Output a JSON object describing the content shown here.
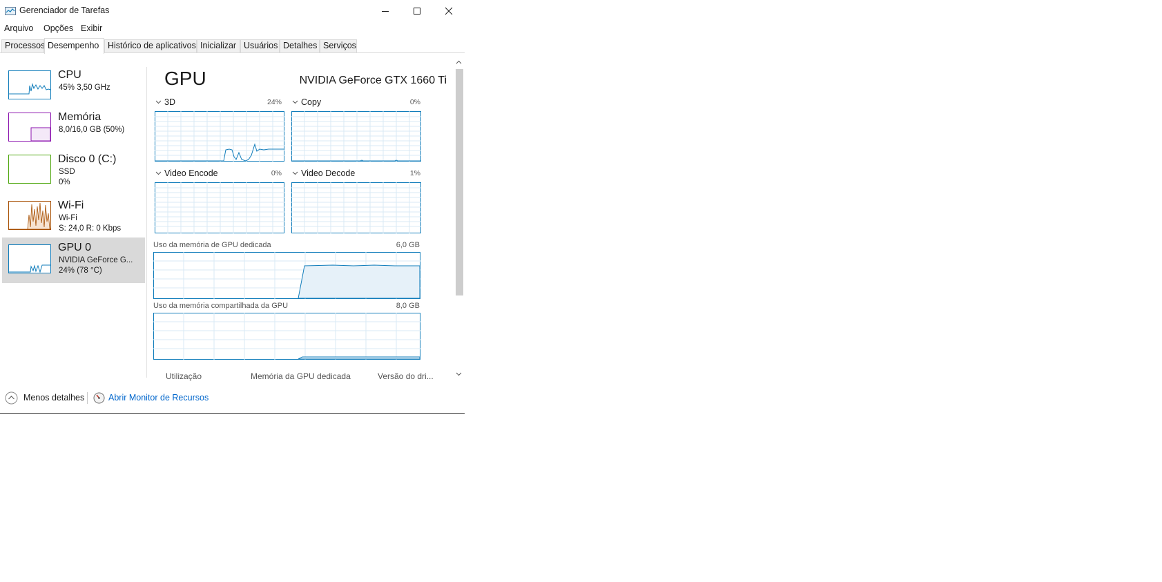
{
  "window": {
    "title": "Gerenciador de Tarefas"
  },
  "menu": [
    "Arquivo",
    "Opções",
    "Exibir"
  ],
  "tabs": [
    "Processos",
    "Desempenho",
    "Histórico de aplicativos",
    "Inicializar",
    "Usuários",
    "Detalhes",
    "Serviços"
  ],
  "active_tab": "Desempenho",
  "sidebar": {
    "items": [
      {
        "name": "CPU",
        "line1": "45%  3,50 GHz",
        "line2": "",
        "color": "#117dbb"
      },
      {
        "name": "Memória",
        "line1": "8,0/16,0 GB (50%)",
        "line2": "",
        "color": "#8b12ae"
      },
      {
        "name": "Disco 0 (C:)",
        "line1": "SSD",
        "line2": "0%",
        "color": "#4da60c"
      },
      {
        "name": "Wi-Fi",
        "line1": "Wi-Fi",
        "line2": "S: 24,0  R: 0 Kbps",
        "color": "#a74f01"
      },
      {
        "name": "GPU 0",
        "line1": "NVIDIA GeForce G...",
        "line2": "24%  (78 °C)",
        "color": "#117dbb",
        "selected": true
      }
    ]
  },
  "main": {
    "title": "GPU",
    "model": "NVIDIA GeForce GTX 1660 Ti",
    "engines": [
      {
        "label": "3D",
        "pct": "24%"
      },
      {
        "label": "Copy",
        "pct": "0%"
      },
      {
        "label": "Video Encode",
        "pct": "0%"
      },
      {
        "label": "Video Decode",
        "pct": "1%"
      }
    ],
    "dedicated": {
      "label": "Uso da memória de GPU dedicada",
      "max": "6,0 GB"
    },
    "shared": {
      "label": "Uso da memória compartilhada da GPU",
      "max": "8,0 GB"
    },
    "bottom_headers": [
      "Utilização",
      "Memória da GPU dedicada",
      "Versão do dri..."
    ]
  },
  "footer": {
    "less_details": "Menos detalhes",
    "open_monitor": "Abrir Monitor de Recursos"
  },
  "colors": {
    "accent_line": "#117dbb",
    "link": "#0066cc",
    "selected_bg": "#d9d9d9",
    "grid": "#d9eaf4"
  }
}
